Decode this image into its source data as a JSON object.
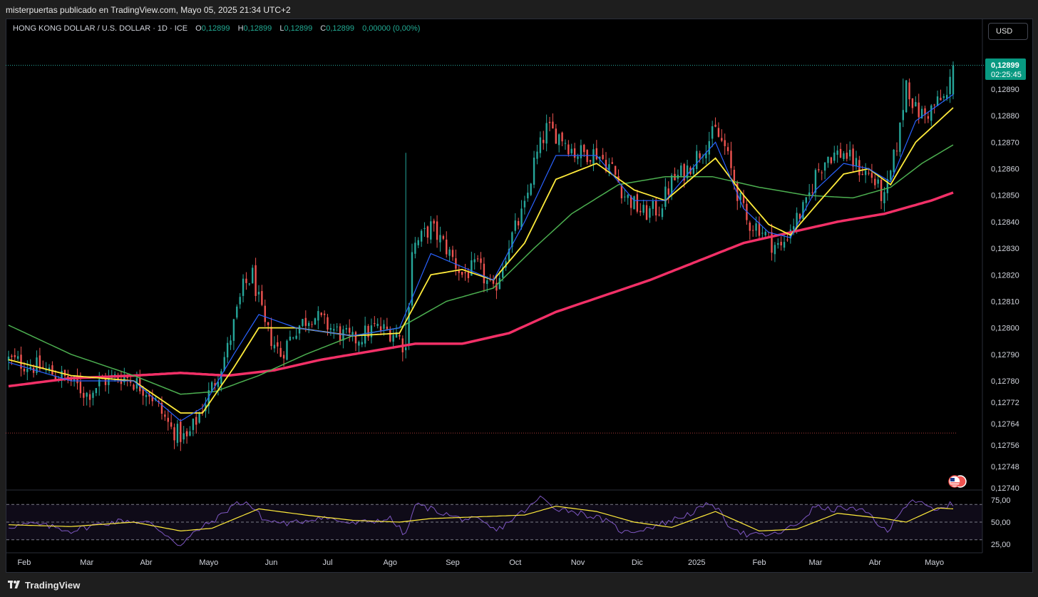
{
  "header": {
    "publish_line": "misterpuertas publicado en TradingView.com, Mayo 05, 2025 21:34 UTC+2"
  },
  "legend": {
    "symbol": "HONG KONG DOLLAR / U.S. DOLLAR · 1D · ICE",
    "open_label": "O",
    "open_value": "0,12899",
    "high_label": "H",
    "high_value": "0,12899",
    "low_label": "L",
    "low_value": "0,12899",
    "close_label": "C",
    "close_value": "0,12899",
    "change": "0,00000 (0,00%)"
  },
  "currency_button": "USD",
  "footer": {
    "brand": "TradingView"
  },
  "colors": {
    "up": "#26a69a",
    "down": "#ef5350",
    "ema_fast": "#2962ff",
    "ema_yellow": "#ffeb3b",
    "sma_green": "#4caf50",
    "sma_long": "#f23067",
    "rsi": "#7e57c2",
    "rsi_ma": "#ffeb3b",
    "price_tag": "#089981",
    "background": "#000000",
    "grid_dash": "#787b86"
  },
  "chart_data": [
    {
      "type": "candlestick",
      "title": "HONG KONG DOLLAR / U.S. DOLLAR · 1D · ICE",
      "xlabel": "",
      "ylabel": "",
      "x_ticks": [
        "Feb",
        "Mar",
        "Abr",
        "Mayo",
        "Jun",
        "Jul",
        "Ago",
        "Sep",
        "Oct",
        "Nov",
        "Dic",
        "2025",
        "Feb",
        "Mar",
        "Abr",
        "Mayo"
      ],
      "y_ticks": [
        "0,12890",
        "0,12880",
        "0,12870",
        "0,12860",
        "0,12850",
        "0,12840",
        "0,12830",
        "0,12820",
        "0,12810",
        "0,12800",
        "0,12790",
        "0,12780",
        "0,12772",
        "0,12764",
        "0,12756",
        "0,12748",
        "0,12740"
      ],
      "ylim": [
        0.1274,
        0.12899
      ],
      "last_price": "0,12899",
      "countdown": "02:25:45",
      "close_path": [
        [
          0,
          0.12788
        ],
        [
          10,
          0.12785
        ],
        [
          20,
          0.1278
        ],
        [
          25,
          0.12775
        ],
        [
          30,
          0.1278
        ],
        [
          37,
          0.12782
        ],
        [
          45,
          0.12776
        ],
        [
          52,
          0.12762
        ],
        [
          57,
          0.12758
        ],
        [
          62,
          0.1277
        ],
        [
          66,
          0.1278
        ],
        [
          70,
          0.12792
        ],
        [
          75,
          0.12815
        ],
        [
          78,
          0.1282
        ],
        [
          82,
          0.128
        ],
        [
          87,
          0.1279
        ],
        [
          92,
          0.128
        ],
        [
          97,
          0.12805
        ],
        [
          103,
          0.128
        ],
        [
          110,
          0.12795
        ],
        [
          117,
          0.128
        ],
        [
          124,
          0.12798
        ],
        [
          127,
          0.12792
        ],
        [
          129,
          0.1283
        ],
        [
          135,
          0.12838
        ],
        [
          140,
          0.1283
        ],
        [
          145,
          0.1282
        ],
        [
          150,
          0.12823
        ],
        [
          155,
          0.12813
        ],
        [
          160,
          0.12832
        ],
        [
          165,
          0.12845
        ],
        [
          168,
          0.12862
        ],
        [
          172,
          0.12875
        ],
        [
          177,
          0.12872
        ],
        [
          181,
          0.12866
        ],
        [
          188,
          0.12866
        ],
        [
          193,
          0.1286
        ],
        [
          197,
          0.1285
        ],
        [
          203,
          0.12843
        ],
        [
          208,
          0.12845
        ],
        [
          212,
          0.12855
        ],
        [
          217,
          0.1286
        ],
        [
          222,
          0.12868
        ],
        [
          226,
          0.12874
        ],
        [
          229,
          0.12868
        ],
        [
          232,
          0.12855
        ],
        [
          236,
          0.1284
        ],
        [
          240,
          0.12838
        ],
        [
          244,
          0.12832
        ],
        [
          247,
          0.1283
        ],
        [
          250,
          0.12838
        ],
        [
          255,
          0.12846
        ],
        [
          258,
          0.12858
        ],
        [
          262,
          0.12865
        ],
        [
          267,
          0.12866
        ],
        [
          272,
          0.1286
        ],
        [
          276,
          0.12857
        ],
        [
          280,
          0.12848
        ],
        [
          282,
          0.12858
        ],
        [
          285,
          0.12875
        ],
        [
          287,
          0.12893
        ],
        [
          290,
          0.12882
        ],
        [
          293,
          0.1288
        ],
        [
          297,
          0.12885
        ],
        [
          300,
          0.12887
        ],
        [
          302,
          0.12899
        ]
      ],
      "ema_fast": [
        [
          0,
          0.12787
        ],
        [
          20,
          0.1278
        ],
        [
          40,
          0.1278
        ],
        [
          55,
          0.12765
        ],
        [
          62,
          0.1277
        ],
        [
          72,
          0.1279
        ],
        [
          80,
          0.12805
        ],
        [
          92,
          0.128
        ],
        [
          110,
          0.12797
        ],
        [
          125,
          0.128
        ],
        [
          135,
          0.12828
        ],
        [
          145,
          0.12823
        ],
        [
          155,
          0.12818
        ],
        [
          165,
          0.1284
        ],
        [
          175,
          0.12865
        ],
        [
          188,
          0.12865
        ],
        [
          200,
          0.12848
        ],
        [
          210,
          0.12848
        ],
        [
          220,
          0.12862
        ],
        [
          226,
          0.1287
        ],
        [
          235,
          0.12845
        ],
        [
          243,
          0.12836
        ],
        [
          250,
          0.12834
        ],
        [
          258,
          0.12852
        ],
        [
          267,
          0.12862
        ],
        [
          275,
          0.1286
        ],
        [
          282,
          0.12855
        ],
        [
          290,
          0.12878
        ],
        [
          302,
          0.12888
        ]
      ],
      "ema_yellow": [
        [
          0,
          0.12788
        ],
        [
          20,
          0.12782
        ],
        [
          40,
          0.1278
        ],
        [
          55,
          0.12768
        ],
        [
          62,
          0.12768
        ],
        [
          72,
          0.12785
        ],
        [
          80,
          0.128
        ],
        [
          92,
          0.128
        ],
        [
          110,
          0.12797
        ],
        [
          125,
          0.12798
        ],
        [
          135,
          0.1282
        ],
        [
          145,
          0.12822
        ],
        [
          155,
          0.12818
        ],
        [
          165,
          0.12832
        ],
        [
          175,
          0.12856
        ],
        [
          188,
          0.12862
        ],
        [
          200,
          0.12852
        ],
        [
          210,
          0.12848
        ],
        [
          220,
          0.12858
        ],
        [
          226,
          0.12864
        ],
        [
          235,
          0.1285
        ],
        [
          243,
          0.12839
        ],
        [
          250,
          0.12835
        ],
        [
          258,
          0.12846
        ],
        [
          267,
          0.12858
        ],
        [
          275,
          0.1286
        ],
        [
          282,
          0.12854
        ],
        [
          290,
          0.1287
        ],
        [
          302,
          0.12883
        ]
      ],
      "sma_green": [
        [
          0,
          0.12801
        ],
        [
          20,
          0.1279
        ],
        [
          40,
          0.12782
        ],
        [
          55,
          0.12775
        ],
        [
          66,
          0.12776
        ],
        [
          80,
          0.12782
        ],
        [
          95,
          0.1279
        ],
        [
          110,
          0.12797
        ],
        [
          125,
          0.128
        ],
        [
          140,
          0.1281
        ],
        [
          155,
          0.12815
        ],
        [
          168,
          0.1283
        ],
        [
          180,
          0.12843
        ],
        [
          195,
          0.12854
        ],
        [
          210,
          0.12857
        ],
        [
          225,
          0.12857
        ],
        [
          240,
          0.12853
        ],
        [
          255,
          0.1285
        ],
        [
          270,
          0.12849
        ],
        [
          282,
          0.12853
        ],
        [
          292,
          0.12862
        ],
        [
          302,
          0.12869
        ]
      ],
      "sma_long": [
        [
          0,
          0.12778
        ],
        [
          20,
          0.12781
        ],
        [
          40,
          0.12782
        ],
        [
          55,
          0.12783
        ],
        [
          70,
          0.12782
        ],
        [
          85,
          0.12784
        ],
        [
          100,
          0.12788
        ],
        [
          115,
          0.12791
        ],
        [
          130,
          0.12794
        ],
        [
          145,
          0.12794
        ],
        [
          160,
          0.12798
        ],
        [
          175,
          0.12806
        ],
        [
          190,
          0.12812
        ],
        [
          205,
          0.12818
        ],
        [
          220,
          0.12825
        ],
        [
          235,
          0.12832
        ],
        [
          250,
          0.12836
        ],
        [
          265,
          0.1284
        ],
        [
          280,
          0.12843
        ],
        [
          295,
          0.12848
        ],
        [
          302,
          0.12851
        ]
      ]
    },
    {
      "type": "line",
      "title": "",
      "xlabel": "",
      "ylabel": "",
      "y_ticks": [
        "75,00",
        "50,00",
        "25,00"
      ],
      "ylim": [
        20,
        80
      ],
      "levels": [
        70,
        50,
        30
      ],
      "rsi": [
        [
          0,
          45
        ],
        [
          8,
          48
        ],
        [
          15,
          44
        ],
        [
          20,
          40
        ],
        [
          28,
          47
        ],
        [
          37,
          52
        ],
        [
          45,
          49
        ],
        [
          52,
          32
        ],
        [
          55,
          23
        ],
        [
          60,
          40
        ],
        [
          67,
          55
        ],
        [
          72,
          70
        ],
        [
          76,
          73
        ],
        [
          82,
          52
        ],
        [
          90,
          48
        ],
        [
          100,
          56
        ],
        [
          110,
          48
        ],
        [
          122,
          54
        ],
        [
          127,
          35
        ],
        [
          130,
          70
        ],
        [
          136,
          64
        ],
        [
          143,
          55
        ],
        [
          150,
          52
        ],
        [
          156,
          40
        ],
        [
          162,
          56
        ],
        [
          167,
          68
        ],
        [
          170,
          78
        ],
        [
          175,
          66
        ],
        [
          181,
          62
        ],
        [
          190,
          53
        ],
        [
          197,
          38
        ],
        [
          205,
          44
        ],
        [
          212,
          52
        ],
        [
          218,
          60
        ],
        [
          225,
          72
        ],
        [
          230,
          48
        ],
        [
          236,
          35
        ],
        [
          245,
          36
        ],
        [
          252,
          47
        ],
        [
          258,
          68
        ],
        [
          262,
          64
        ],
        [
          268,
          66
        ],
        [
          275,
          60
        ],
        [
          281,
          37
        ],
        [
          285,
          63
        ],
        [
          289,
          76
        ],
        [
          293,
          68
        ],
        [
          297,
          62
        ],
        [
          300,
          69
        ],
        [
          302,
          70
        ]
      ],
      "rsi_ma": [
        [
          0,
          47
        ],
        [
          20,
          45
        ],
        [
          40,
          50
        ],
        [
          55,
          40
        ],
        [
          65,
          43
        ],
        [
          80,
          65
        ],
        [
          95,
          58
        ],
        [
          110,
          52
        ],
        [
          125,
          50
        ],
        [
          135,
          54
        ],
        [
          150,
          56
        ],
        [
          165,
          58
        ],
        [
          175,
          68
        ],
        [
          188,
          62
        ],
        [
          200,
          50
        ],
        [
          212,
          44
        ],
        [
          226,
          62
        ],
        [
          240,
          40
        ],
        [
          252,
          42
        ],
        [
          265,
          60
        ],
        [
          280,
          54
        ],
        [
          287,
          50
        ],
        [
          297,
          66
        ],
        [
          302,
          65
        ]
      ]
    }
  ]
}
